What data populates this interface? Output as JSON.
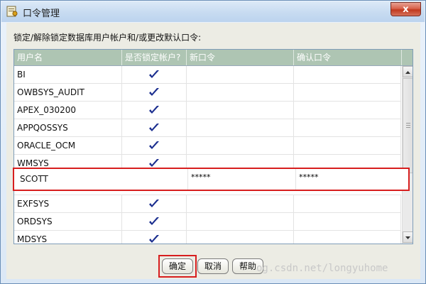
{
  "window": {
    "title": "口令管理",
    "close_label": "x"
  },
  "instruction": "锁定/解除锁定数据库用户帐户和/或更改默认口令:",
  "table": {
    "columns": [
      "用户名",
      "是否锁定帐户?",
      "新口令",
      "确认口令"
    ],
    "rows": [
      {
        "username": "BI",
        "locked": true
      },
      {
        "username": "OWBSYS_AUDIT",
        "locked": true
      },
      {
        "username": "APEX_030200",
        "locked": true
      },
      {
        "username": "APPQOSSYS",
        "locked": true
      },
      {
        "username": "ORACLE_OCM",
        "locked": true
      },
      {
        "username": "WMSYS",
        "locked": true
      },
      {
        "username": "SCOTT",
        "locked": false,
        "new_password": "*****",
        "confirm_password": "*****"
      },
      {
        "username": "EXFSYS",
        "locked": true
      },
      {
        "username": "ORDSYS",
        "locked": true
      },
      {
        "username": "MDSYS",
        "locked": true
      }
    ]
  },
  "buttons": {
    "ok": "确定",
    "cancel": "取消",
    "help": "帮助"
  },
  "watermark": "og.csdn.net/longyuhome",
  "colors": {
    "highlight": "#d71e1e",
    "check": "#1b2e8f",
    "header_bg": "#aec5b3"
  }
}
